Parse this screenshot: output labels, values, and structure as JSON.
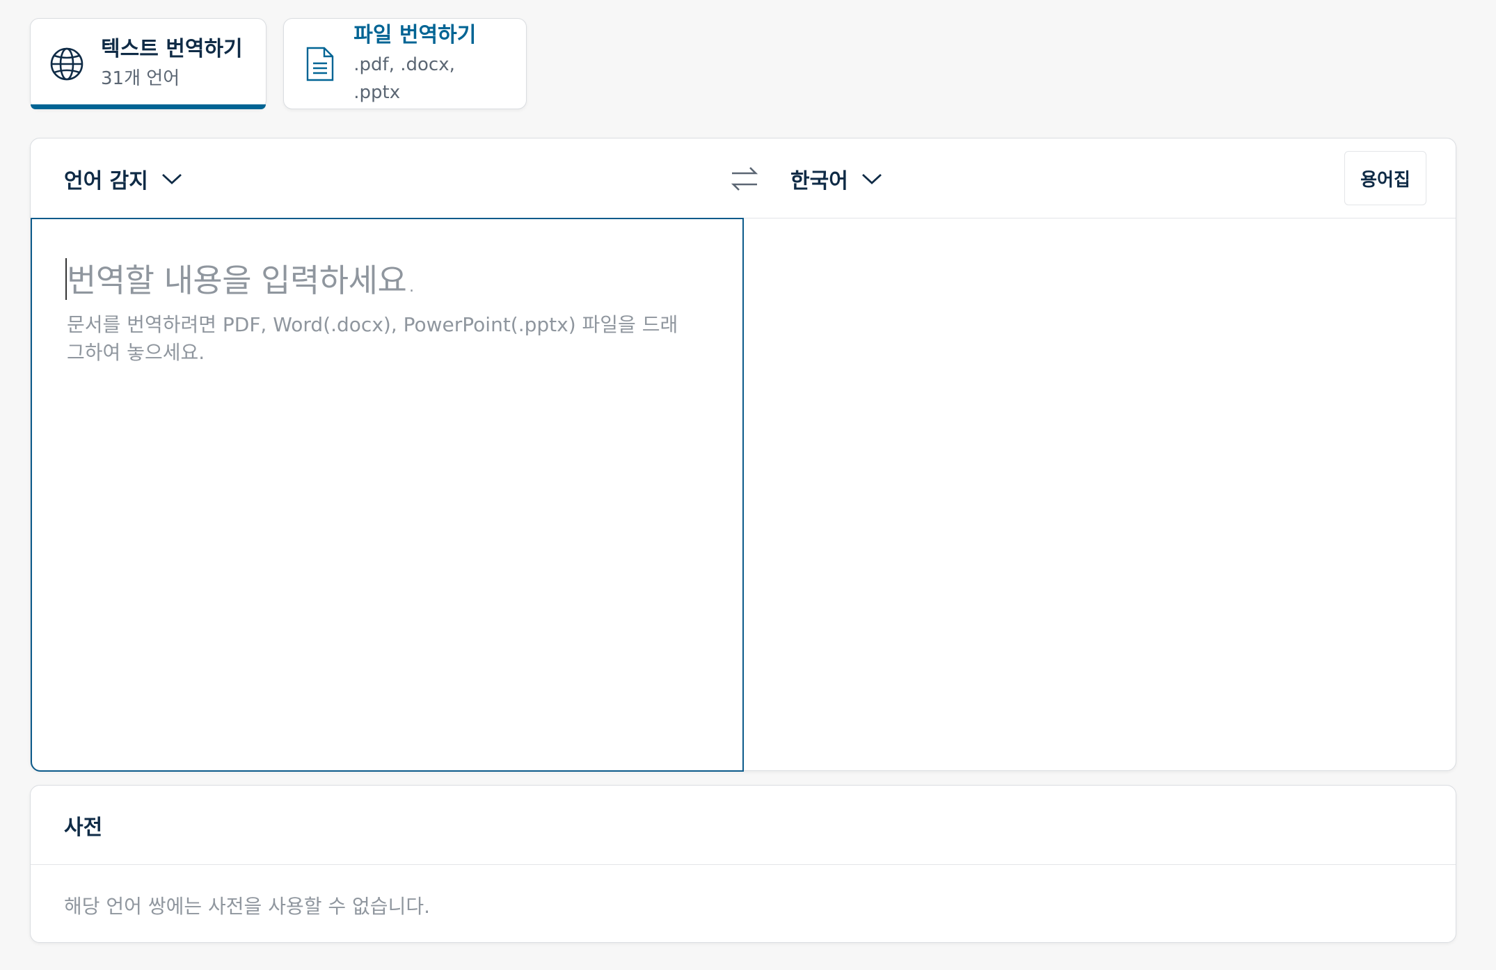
{
  "tabs": {
    "text": {
      "title": "텍스트 번역하기",
      "subtitle": "31개 언어",
      "icon": "globe-icon",
      "active": true
    },
    "file": {
      "title": "파일 번역하기",
      "subtitle": ".pdf, .docx, .pptx",
      "icon": "document-icon"
    }
  },
  "translator": {
    "source_lang": "언어 감지",
    "target_lang": "한국어",
    "swap_icon": "swap-arrows-icon",
    "glossary_label": "용어집",
    "placeholder": "번역할 내용을 입력하세요.",
    "hint": "문서를 번역하려면 PDF, Word(.docx), PowerPoint(.pptx) 파일을 드래그하여 놓으세요."
  },
  "dictionary": {
    "title": "사전",
    "message": "해당 언어 쌍에는 사전을 사용할 수 없습니다."
  },
  "colors": {
    "accent": "#006494",
    "text": "#0f2b46",
    "muted": "#8f969e",
    "background": "#f7f7f7"
  }
}
